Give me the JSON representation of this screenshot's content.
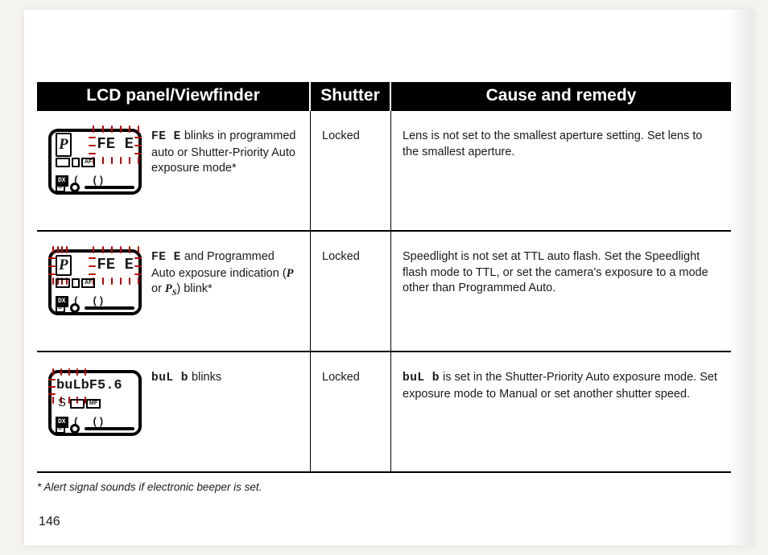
{
  "header": {
    "col1": "LCD panel/Viewfinder",
    "col2": "Shutter",
    "col3": "Cause and remedy"
  },
  "rows": [
    {
      "icon": {
        "mode": "P",
        "readout": "FE E",
        "blink_mode": false,
        "blink_readout": true
      },
      "lcd_code": "FE E",
      "lcd_text_after": " blinks in programmed auto or Shutter-Priority Auto exposure mode*",
      "shutter": "Locked",
      "remedy_pre": "",
      "remedy_code": "",
      "remedy_post": "Lens is not set to the smallest aperture setting. Set lens to the smallest aperture."
    },
    {
      "icon": {
        "mode": "P",
        "readout": "FE E",
        "blink_mode": true,
        "blink_readout": true
      },
      "lcd_code": "FE E",
      "lcd_text_after_1": " and Programmed Auto exposure indication (",
      "lcd_italic_1": "P",
      "lcd_text_after_2": " or ",
      "lcd_italic_2": "P",
      "lcd_sub": "S",
      "lcd_text_after_3": ") blink*",
      "shutter": "Locked",
      "remedy_pre": "",
      "remedy_code": "",
      "remedy_post": "Speedlight is not set at TTL auto flash. Set the Speedlight flash mode to TTL, or set the camera's exposure to a mode other than Programmed Auto."
    },
    {
      "icon": {
        "mode": "S",
        "readout": "buLbF5.6",
        "blink_mode": false,
        "blink_readout_partial": "bulb"
      },
      "lcd_code": "buL b",
      "lcd_text_after": " blinks",
      "shutter": "Locked",
      "remedy_pre": "",
      "remedy_code": "buL b",
      "remedy_post": " is set in the Shutter-Priority Auto exposure mode. Set exposure mode to Manual or set another shutter speed."
    }
  ],
  "footnote": "* Alert signal sounds if electronic beeper is set.",
  "page_number": "146"
}
